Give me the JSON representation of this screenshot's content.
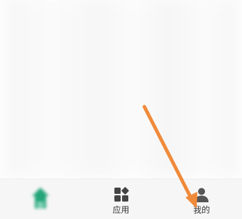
{
  "tab_bar": {
    "tabs": [
      {
        "id": "home",
        "label": "",
        "icon": "home-icon",
        "active": true,
        "color": "#23a479"
      },
      {
        "id": "apps",
        "label": "应用",
        "icon": "apps-grid-icon",
        "active": false,
        "color": "#444444"
      },
      {
        "id": "mine",
        "label": "我的",
        "icon": "person-icon",
        "active": false,
        "color": "#555555"
      }
    ]
  },
  "annotation": {
    "arrow_color": "#f08a3a",
    "icon": "arrow-icon"
  }
}
